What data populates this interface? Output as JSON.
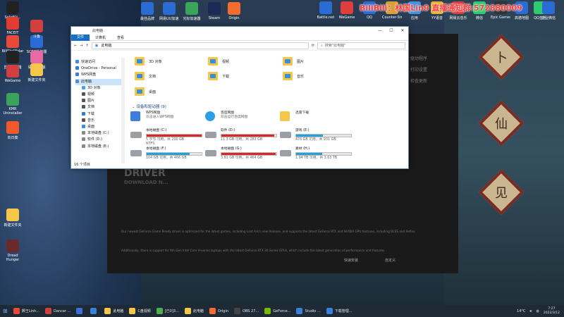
{
  "desktop": {
    "banner": "BiliBili：林国Lin9  直播通知群:572880009",
    "icons_left": [
      "SolidKil...",
      "FACEIT",
      "BiliSkaWalar",
      "SCRB操作器",
      "斗鱼",
      "剪映工具箱2022",
      "易学专业版",
      "新建文件夹",
      "WeGame",
      "KMR Uninstaller",
      "向日葵",
      "新建文件夹",
      "Dread Hunger"
    ],
    "icons_top": [
      "最佳品牌",
      "网易UU加速器",
      "光标加速器",
      "Steam",
      "Origin",
      "Battle.net",
      "WeGame",
      "QQ",
      "Counter-Strike Global O...",
      "应用",
      "YY语音",
      "网易云音乐",
      "微信",
      "Epic Games",
      "高德地图",
      "QQ音乐",
      "企业微信",
      "腾讯会议"
    ],
    "lantern_glyphs": [
      "卜",
      "仙",
      "见"
    ]
  },
  "geforce": {
    "heading": "DRIVER",
    "subheading": "DOWNLOAD N...",
    "side_items": [
      "驱动程序",
      "打印设置",
      "检查更新"
    ],
    "para1": "Our newest GeForce Game Ready driver is optimized for the latest games, including Lost Ark's new Release, and supports the latest GeForce RTX and NVIDIA GPU features, including DLSS and Reflex.",
    "para2": "Additionally, there is support for 9th Gen Intel Core H-series laptops with the latest GeForce RTX 30 Series GPUs, which include the latest generation of performance and features.",
    "button_express": "快速安装",
    "button_custom": "自定义"
  },
  "explorer": {
    "title": "此电脑",
    "controls": [
      "—",
      "☐",
      "✕"
    ],
    "ribbon": [
      "文件",
      "计算机",
      "查看"
    ],
    "address": "此电脑",
    "search_placeholder": "搜索\"此电脑\"",
    "nav": [
      {
        "label": "快速访问",
        "indent": false,
        "color": "#3a8ee6"
      },
      {
        "label": "OneDrive - Personal",
        "indent": false,
        "color": "#2c7bd4"
      },
      {
        "label": "WPS网盘",
        "indent": false,
        "color": "#3a7fe0"
      },
      {
        "label": "此电脑",
        "indent": false,
        "color": "#4a90d9",
        "selected": true
      },
      {
        "label": "3D 对象",
        "indent": true,
        "color": "#4aa0e6"
      },
      {
        "label": "视频",
        "indent": true,
        "color": "#555555"
      },
      {
        "label": "图片",
        "indent": true,
        "color": "#555555"
      },
      {
        "label": "文档",
        "indent": true,
        "color": "#555555"
      },
      {
        "label": "下载",
        "indent": true,
        "color": "#2a7fd0"
      },
      {
        "label": "音乐",
        "indent": true,
        "color": "#555555"
      },
      {
        "label": "桌面",
        "indent": true,
        "color": "#3a8ee6"
      },
      {
        "label": "本地磁盘 (C:)",
        "indent": true,
        "color": "#888888"
      },
      {
        "label": "软件 (D:)",
        "indent": true,
        "color": "#888888"
      },
      {
        "label": "本地磁盘 (E:)",
        "indent": true,
        "color": "#888888"
      }
    ],
    "status": "16 个项目",
    "folders": [
      "3D 对象",
      "视频",
      "图片",
      "文档",
      "下载",
      "音乐",
      "桌面"
    ],
    "section_title": "设备和驱动器 (9)",
    "devices": [
      {
        "name": "WPS网盘",
        "sub": "双击进入WPS网盘"
      },
      {
        "name": "百度网盘",
        "sub": "双击运行百度网盘"
      },
      {
        "name": "迅雷下载",
        "sub": ""
      }
    ],
    "drives": [
      {
        "name": "本地磁盘 (C:)",
        "free": "5 字节 可用，共 200 GB",
        "fs": "NTFS",
        "fill": 1.0,
        "color": "#da2626"
      },
      {
        "name": "软件 (D:)",
        "free": "11.3 GB 可用，共 283 GB",
        "fill": 0.96,
        "color": "#da2626"
      },
      {
        "name": "游戏 (E:)",
        "free": "476 GB 可用，共 931 GB",
        "fill": 0.49,
        "color": "#26a0da"
      },
      {
        "name": "本地磁盘 (F:)",
        "free": "104 GB 可用，共 466 GB",
        "fill": 0.78,
        "color": "#26a0da"
      },
      {
        "name": "本地磁盘 (G:)",
        "free": "3.81 GB 可用，共 464 GB",
        "fill": 0.99,
        "color": "#da2626"
      },
      {
        "name": "素材 (H:)",
        "free": "1.94 TB 可用，共 3.63 TB",
        "fill": 0.47,
        "color": "#26a0da"
      }
    ]
  },
  "taskbar": {
    "items": [
      {
        "label": "狮王Linh...",
        "color": "#e84a3a"
      },
      {
        "label": "Dancer ...",
        "color": "#d23f3f"
      },
      {
        "label": "",
        "color": "#3a6fd8"
      },
      {
        "label": "",
        "color": "#3a7fd8"
      },
      {
        "label": "此电脑",
        "color": "#f4c64a"
      },
      {
        "label": "C盘视频",
        "color": "#f4c64a"
      },
      {
        "label": "[已0]3...",
        "color": "#4caf50"
      },
      {
        "label": "此电脑",
        "color": "#f4c64a"
      },
      {
        "label": "Origin",
        "color": "#f56c2d"
      },
      {
        "label": "OBS 27...",
        "color": "#444444"
      },
      {
        "label": "GeForce...",
        "color": "#76b900"
      },
      {
        "label": "Studio ...",
        "color": "#3a7fd8"
      },
      {
        "label": "下载管理...",
        "color": "#3a7fd8"
      }
    ],
    "weather": "14°C",
    "time": "7:27",
    "date": "2022/3/12"
  }
}
